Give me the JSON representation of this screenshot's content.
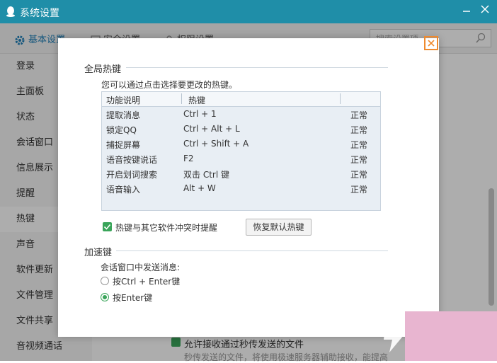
{
  "window": {
    "title": "系统设置"
  },
  "tabs": {
    "basic": "基本设置",
    "security": "安全设置",
    "permission": "权限设置"
  },
  "search": {
    "placeholder": "搜索设置项"
  },
  "sidebar": {
    "items": [
      {
        "label": "登录"
      },
      {
        "label": "主面板"
      },
      {
        "label": "状态"
      },
      {
        "label": "会话窗口"
      },
      {
        "label": "信息展示"
      },
      {
        "label": "提醒"
      },
      {
        "label": "热键"
      },
      {
        "label": "声音"
      },
      {
        "label": "软件更新"
      },
      {
        "label": "文件管理"
      },
      {
        "label": "文件共享"
      },
      {
        "label": "音视频通话"
      }
    ],
    "active_index": 6
  },
  "background": {
    "checkbox_label": "允许接收通过秒传发送的文件",
    "sub_text": "秒传发送的文件，将使用极速服务器辅助接收，能提高"
  },
  "dialog": {
    "global_hotkeys_title": "全局热键",
    "hint": "您可以通过点击选择要更改的热键。",
    "table": {
      "headers": [
        "功能说明",
        "热键"
      ],
      "rows": [
        {
          "func": "提取消息",
          "key": "Ctrl + 1",
          "status": "正常"
        },
        {
          "func": "锁定QQ",
          "key": "Ctrl + Alt + L",
          "status": "正常"
        },
        {
          "func": "捕捉屏幕",
          "key": "Ctrl + Shift + A",
          "status": "正常"
        },
        {
          "func": "语音按键说话",
          "key": "F2",
          "status": "正常"
        },
        {
          "func": "开启划词搜索",
          "key": "双击 Ctrl 键",
          "status": "正常"
        },
        {
          "func": "语音输入",
          "key": "Alt + W",
          "status": "正常"
        }
      ]
    },
    "conflict_checkbox": "热键与其它软件冲突时提醒",
    "restore_button": "恢复默认热键",
    "accel_title": "加速键",
    "send_label": "会话窗口中发送消息:",
    "options": [
      {
        "label": "按Ctrl + Enter键",
        "selected": false
      },
      {
        "label": "按Enter键",
        "selected": true
      }
    ]
  },
  "colors": {
    "titlebar": "#1f8ea8",
    "accent_green": "#3aa55a",
    "close_highlight": "#ef8a2e"
  }
}
